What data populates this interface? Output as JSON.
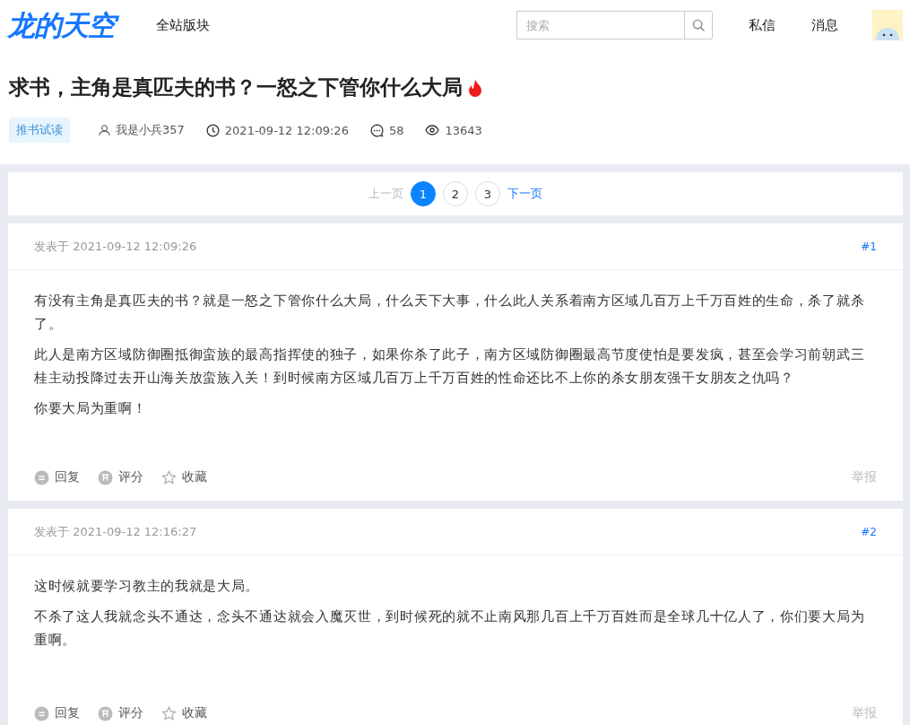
{
  "header": {
    "logo": "龙的天空",
    "nav": "全站版块",
    "search": {
      "placeholder": "搜索"
    },
    "links": [
      "私信",
      "消息"
    ]
  },
  "thread": {
    "title": "求书，主角是真匹夫的书？一怒之下管你什么大局",
    "hot": true,
    "tag": "推书试读",
    "author": "我是小兵357",
    "time": "2021-09-12 12:09:26",
    "replies": "58",
    "views": "13643"
  },
  "pagination": {
    "prev": {
      "label": "上一页",
      "disabled": true
    },
    "pages": [
      {
        "label": "1",
        "selected": true
      },
      {
        "label": "2",
        "selected": false
      },
      {
        "label": "3",
        "selected": false
      }
    ],
    "next": {
      "label": "下一页",
      "disabled": false
    }
  },
  "posts": [
    {
      "meta": "发表于 2021-09-12 12:09:26",
      "floor": "#1",
      "paragraphs": [
        "有没有主角是真匹夫的书？就是一怒之下管你什么大局，什么天下大事，什么此人关系着南方区域几百万上千万百姓的生命，杀了就杀了。",
        "此人是南方区域防御圈抵御蛮族的最高指挥使的独子，如果你杀了此子，南方区域防御圈最高节度使怕是要发疯，甚至会学习前朝武三桂主动投降过去开山海关放蛮族入关！到时候南方区域几百万上千万百姓的性命还比不上你的杀女朋友强干女朋友之仇吗？",
        "你要大局为重啊！"
      ],
      "actions": [
        "回复",
        "评分",
        "收藏"
      ],
      "report": "举报"
    },
    {
      "meta": "发表于 2021-09-12 12:16:27",
      "floor": "#2",
      "paragraphs": [
        "这时候就要学习教主的我就是大局。",
        "不杀了这人我就念头不通达，念头不通达就会入魔灭世，到时候死的就不止南风那几百上千万百姓而是全球几十亿人了，你们要大局为重啊。"
      ],
      "actions": [
        "回复",
        "评分",
        "收藏"
      ],
      "report": "举报"
    }
  ]
}
